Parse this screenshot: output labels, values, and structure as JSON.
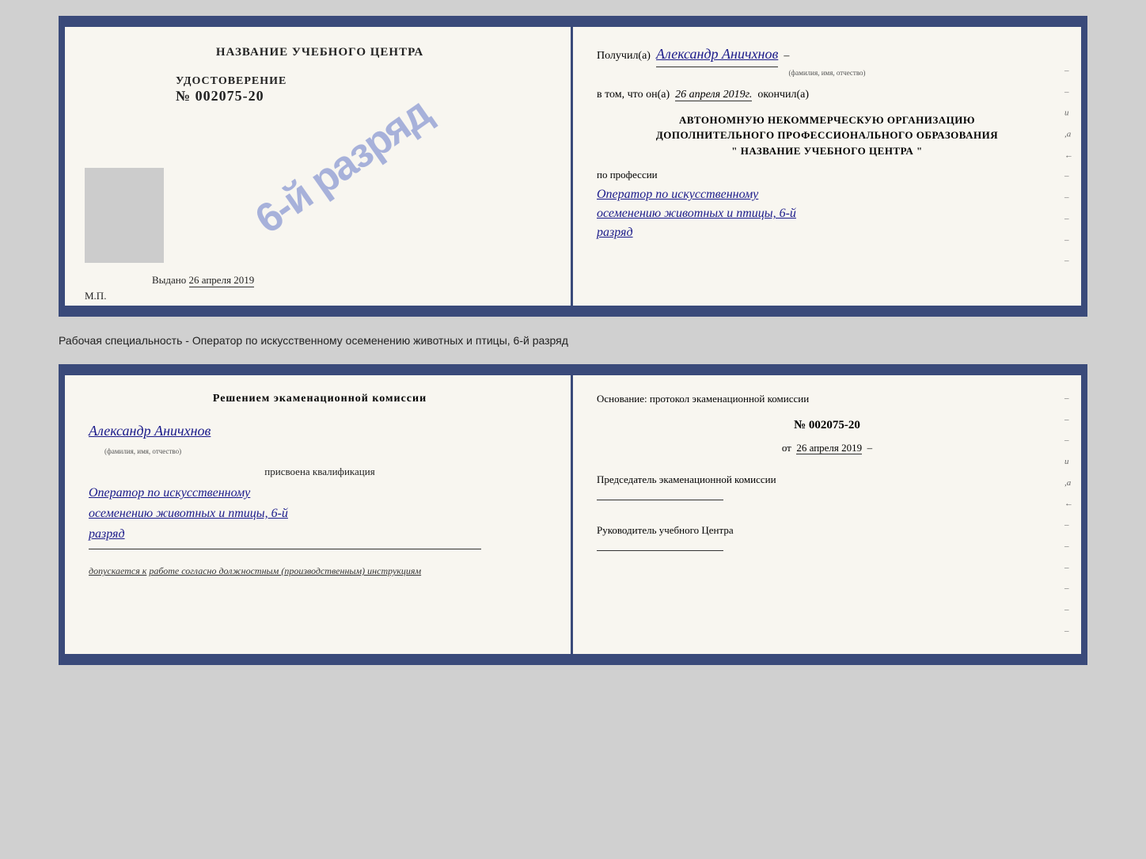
{
  "top": {
    "left": {
      "title": "НАЗВАНИЕ УЧЕБНОГО ЦЕНТРА",
      "udostLabel": "УДОСТОВЕРЕНИЕ",
      "udostNum": "№ 002075-20",
      "vydano": "Выдано",
      "vydanoDate": "26 апреля 2019",
      "mpLabel": "М.П.",
      "stamp": "6-й разряд"
    },
    "right": {
      "poluchil": "Получил(а)",
      "recipientName": "Александр Аничхнов",
      "recipientSubLabel": "(фамилия, имя, отчество)",
      "dash": "–",
      "vtomChto": "в том, что он(а)",
      "date": "26 апреля 2019г.",
      "okonchil": "окончил(а)",
      "orgLine1": "АВТОНОМНУЮ НЕКОММЕРЧЕСКУЮ ОРГАНИЗАЦИЮ",
      "orgLine2": "ДОПОЛНИТЕЛЬНОГО ПРОФЕССИОНАЛЬНОГО ОБРАЗОВАНИЯ",
      "orgLine3": "\"  НАЗВАНИЕ УЧЕБНОГО ЦЕНТРА  \"",
      "profLabel": "по профессии",
      "profText1": "Оператор по искусственному",
      "profText2": "осеменению животных и птицы, 6-й",
      "profText3": "разряд"
    }
  },
  "specialty": {
    "text": "Рабочая специальность - Оператор по искусственному осеменению животных и птицы, 6-й разряд"
  },
  "bottom": {
    "left": {
      "header": "Решением экаменационной комиссии",
      "personName": "Александр Аничхнов",
      "personSubLabel": "(фамилия, имя, отчество)",
      "prisvoena": "присвоена квалификация",
      "qual1": "Оператор по искусственному",
      "qual2": "осеменению животных и птицы, 6-й",
      "qual3": "разряд",
      "dopuskaetsya": "допускается к",
      "dopuskaetsyaText": "работе согласно должностным (производственным) инструкциям"
    },
    "right": {
      "osnovanie": "Основание: протокол экаменационной комиссии",
      "protocolNum": "№ 002075-20",
      "protocolDateLabel": "от",
      "protocolDate": "26 апреля 2019",
      "predsLabel": "Председатель экаменационной комиссии",
      "rukovLabel": "Руководитель учебного Центра"
    }
  }
}
